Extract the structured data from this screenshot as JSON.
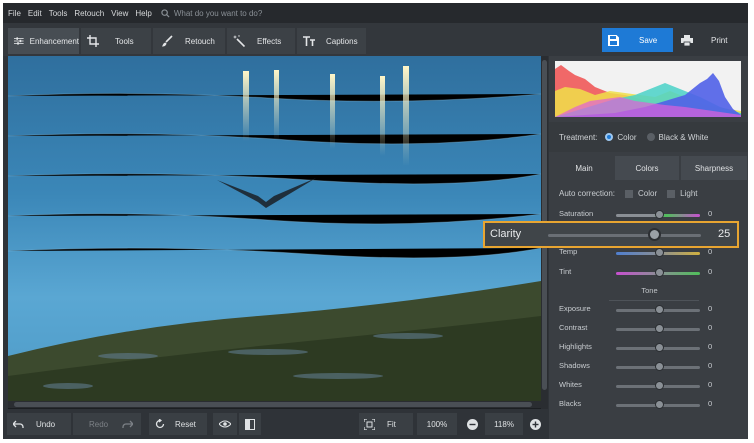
{
  "menu": {
    "items": [
      "File",
      "Edit",
      "Tools",
      "Retouch",
      "View",
      "Help"
    ],
    "search_placeholder": "What do you want to do?"
  },
  "toolbar": {
    "tabs": [
      {
        "label": "Enhancement",
        "icon": "sliders-icon"
      },
      {
        "label": "Tools",
        "icon": "crop-icon"
      },
      {
        "label": "Retouch",
        "icon": "brush-icon"
      },
      {
        "label": "Effects",
        "icon": "magic-wand-icon"
      },
      {
        "label": "Captions",
        "icon": "text-icon"
      }
    ],
    "active_tab": "Enhancement",
    "save_label": "Save",
    "print_label": "Print"
  },
  "bottom": {
    "undo_label": "Undo",
    "redo_label": "Redo",
    "reset_label": "Reset",
    "fit_label": "Fit",
    "zoom_100": "100%",
    "zoom_current": "118%"
  },
  "panel": {
    "treatment_label": "Treatment:",
    "treatment_options": [
      "Color",
      "Black & White"
    ],
    "treatment_selected": "Color",
    "subtabs": [
      "Main",
      "Colors",
      "Sharpness"
    ],
    "subtab_active": "Main",
    "auto_correction_label": "Auto correction:",
    "auto_options": [
      "Color",
      "Light"
    ],
    "sliders_top": [
      {
        "label": "Saturation",
        "value": "0"
      },
      {
        "label": "Temp",
        "value": "0"
      },
      {
        "label": "Tint",
        "value": "0"
      }
    ],
    "tone_label": "Tone",
    "sliders_tone": [
      {
        "label": "Exposure",
        "value": "0"
      },
      {
        "label": "Contrast",
        "value": "0"
      },
      {
        "label": "Highlights",
        "value": "0"
      },
      {
        "label": "Shadows",
        "value": "0"
      },
      {
        "label": "Whites",
        "value": "0"
      },
      {
        "label": "Blacks",
        "value": "0"
      }
    ]
  },
  "clarity": {
    "label": "Clarity",
    "value": "25",
    "level_fraction": 0.67,
    "highlight_color": "#e8a531"
  },
  "colors": {
    "accent": "#1e7ad6"
  }
}
